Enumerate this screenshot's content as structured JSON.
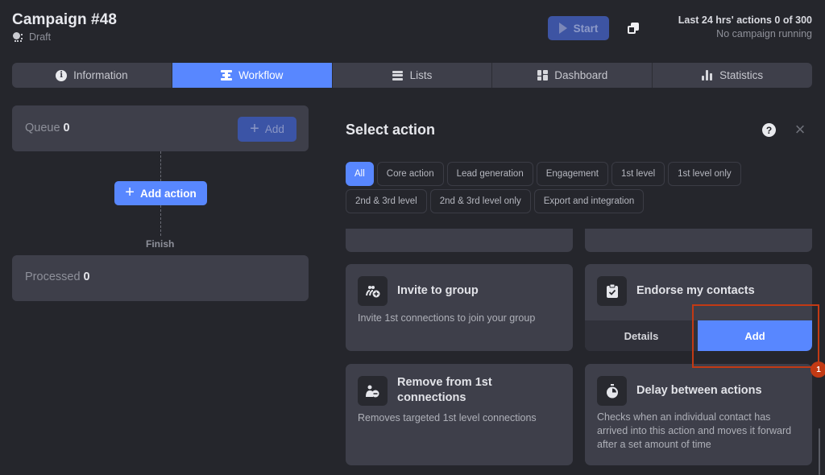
{
  "header": {
    "title": "Campaign #48",
    "status": "Draft",
    "start_label": "Start",
    "quota_line": "Last 24 hrs' actions 0 of 300",
    "running_status": "No campaign running"
  },
  "tabs": [
    {
      "label": "Information",
      "icon": "info-icon",
      "active": false
    },
    {
      "label": "Workflow",
      "icon": "workflow-icon",
      "active": true
    },
    {
      "label": "Lists",
      "icon": "lists-icon",
      "active": false
    },
    {
      "label": "Dashboard",
      "icon": "dashboard-icon",
      "active": false
    },
    {
      "label": "Statistics",
      "icon": "statistics-icon",
      "active": false
    }
  ],
  "workflow": {
    "queue_label": "Queue",
    "queue_count": "0",
    "queue_add_label": "Add",
    "add_action_label": "Add action",
    "finish_label": "Finish",
    "processed_label": "Processed",
    "processed_count": "0"
  },
  "panel": {
    "title": "Select action",
    "help_glyph": "?",
    "close_glyph": "×",
    "filters": [
      {
        "label": "All",
        "active": true
      },
      {
        "label": "Core action",
        "active": false
      },
      {
        "label": "Lead generation",
        "active": false
      },
      {
        "label": "Engagement",
        "active": false
      },
      {
        "label": "1st level",
        "active": false
      },
      {
        "label": "1st level only",
        "active": false
      },
      {
        "label": "2nd & 3rd level",
        "active": false
      },
      {
        "label": "2nd & 3rd level only",
        "active": false
      },
      {
        "label": "Export and integration",
        "active": false
      }
    ],
    "cards": [
      {
        "title": "Invite to group",
        "description": "Invite 1st connections to join your group",
        "icon": "invite-group-icon"
      },
      {
        "title": "Endorse my contacts",
        "description": "",
        "icon": "clipboard-check-icon",
        "details_label": "Details",
        "add_label": "Add"
      },
      {
        "title": "Remove from 1st connections",
        "description": "Removes targeted 1st level connections",
        "icon": "remove-connection-icon"
      },
      {
        "title": "Delay between actions",
        "description": "Checks when an individual contact has arrived into this action and moves it forward after a set amount of time",
        "icon": "stopwatch-icon"
      }
    ]
  },
  "annotation": {
    "badge": "1",
    "color": "#c23a14"
  },
  "colors": {
    "accent": "#5887ff",
    "background": "#25262c",
    "card": "#3e3f4a"
  }
}
